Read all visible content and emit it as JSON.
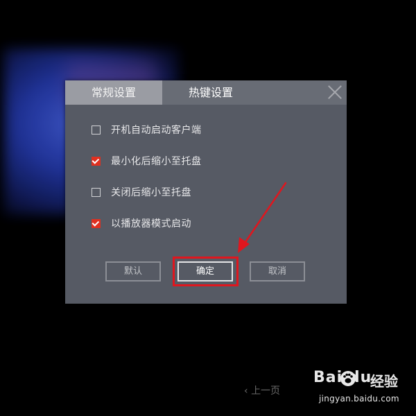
{
  "tabs": {
    "general": "常规设置",
    "hotkeys": "热键设置"
  },
  "options": [
    {
      "label": "开机自动启动客户端",
      "checked": false
    },
    {
      "label": "最小化后缩小至托盘",
      "checked": true
    },
    {
      "label": "关闭后缩小至托盘",
      "checked": false
    },
    {
      "label": "以播放器模式启动",
      "checked": true
    }
  ],
  "buttons": {
    "default": "默认",
    "ok": "确定",
    "cancel": "取消"
  },
  "footer": {
    "prev_label": "上一页"
  },
  "watermark": {
    "brand_text": "Bai du",
    "product": "经验",
    "url": "jingyan.baidu.com"
  },
  "colors": {
    "dialog_bg": "#565a64",
    "tab_active_bg": "#9a9ca3",
    "checkbox_checked": "#e03020",
    "annotation_red": "#e0161e"
  }
}
